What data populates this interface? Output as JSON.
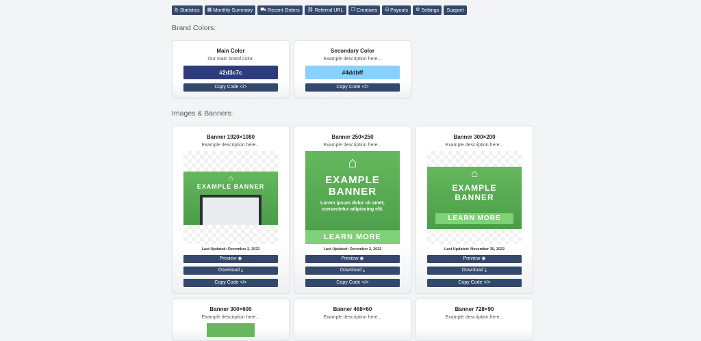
{
  "nav": [
    {
      "label": "Statistics",
      "icon": "chart-icon",
      "glyph": "⊵"
    },
    {
      "label": "Monthly Summary",
      "icon": "calendar-icon",
      "glyph": "▦"
    },
    {
      "label": "Recent Orders",
      "icon": "cart-icon",
      "glyph": "⛟"
    },
    {
      "label": "Referral URL",
      "icon": "link-icon",
      "glyph": "⛓"
    },
    {
      "label": "Creatives",
      "icon": "images-icon",
      "glyph": "❐"
    },
    {
      "label": "Payouts",
      "icon": "money-icon",
      "glyph": "⊟"
    },
    {
      "label": "Settings",
      "icon": "gear-icon",
      "glyph": "⚙"
    },
    {
      "label": "Support",
      "icon": "",
      "glyph": ""
    }
  ],
  "brand": {
    "title": "Brand Colors:",
    "main": {
      "title": "Main Color",
      "desc": "Our main brand color.",
      "hex": "#2d3c7c",
      "text_color": "#ffffff"
    },
    "secondary": {
      "title": "Secondary Color",
      "desc": "Example description here...",
      "hex": "#4ddbff",
      "text_color": "#1a1a1a"
    }
  },
  "images": {
    "title": "Images & Banners:",
    "copy_label": "Copy Code",
    "preview_label": "Preview",
    "download_label": "Download",
    "cards": [
      {
        "title": "Banner 1920×1080",
        "desc": "Example description here...",
        "updated": "Last Updated: December 2, 2022",
        "headline": "EXAMPLE BANNER"
      },
      {
        "title": "Banner 250×250",
        "desc": "Example description here...",
        "updated": "Last Updated: December 2, 2022",
        "headline1": "EXAMPLE",
        "headline2": "BANNER",
        "body": "Lorem ipsum dolor sit amet, consectetur adipiscing elit.",
        "cta": "LEARN MORE"
      },
      {
        "title": "Banner 300×200",
        "desc": "Example description here...",
        "updated": "Last Updated: November 30, 2022",
        "headline1": "EXAMPLE",
        "headline2": "BANNER",
        "cta": "LEARN MORE"
      }
    ],
    "row2": [
      {
        "title": "Banner 300×600",
        "desc": "Example description here..."
      },
      {
        "title": "Banner 468×60",
        "desc": "Example description here..."
      },
      {
        "title": "Banner 728×90",
        "desc": "Example description here..."
      }
    ]
  },
  "colors": {
    "nav": "#34486b",
    "banner_green": "#5aad52"
  }
}
